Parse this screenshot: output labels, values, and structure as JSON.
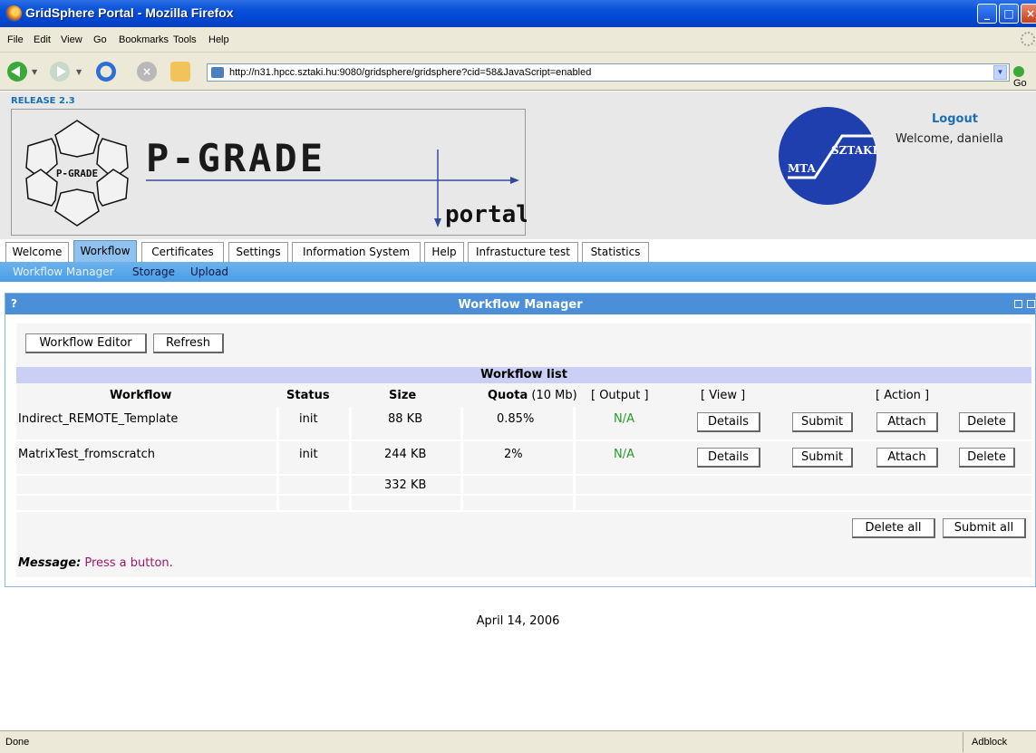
{
  "window": {
    "title": "GridSphere Portal - Mozilla Firefox"
  },
  "menu": [
    "File",
    "Edit",
    "View",
    "Go",
    "Bookmarks",
    "Tools",
    "Help"
  ],
  "address": {
    "url": "http://n31.hpcc.sztaki.hu:9080/gridsphere/gridsphere?cid=58&JavaScript=enabled",
    "go_label": "Go"
  },
  "header": {
    "release": "RELEASE 2.3",
    "logo_text": "P-GRADE",
    "logo_subtext": "portal",
    "small_logo_text": "P-GRADE",
    "partner_logo": {
      "left": "MTA",
      "right": "SZTAKI"
    },
    "logout": "Logout",
    "welcome": "Welcome, daniella"
  },
  "tabs": [
    {
      "label": "Welcome",
      "active": false
    },
    {
      "label": "Workflow",
      "active": true
    },
    {
      "label": "Certificates",
      "active": false
    },
    {
      "label": "Settings",
      "active": false
    },
    {
      "label": "Information System",
      "active": false
    },
    {
      "label": "Help",
      "active": false
    },
    {
      "label": "Infrastucture test",
      "active": false
    },
    {
      "label": "Statistics",
      "active": false
    }
  ],
  "subnav": [
    {
      "label": "Workflow Manager",
      "active": true
    },
    {
      "label": "Storage",
      "active": false
    },
    {
      "label": "Upload",
      "active": false
    }
  ],
  "portlet": {
    "help_marker": "?",
    "title": "Workflow Manager",
    "buttons": {
      "editor": "Workflow Editor",
      "refresh": "Refresh"
    },
    "list_title": "Workflow list",
    "columns": {
      "workflow": "Workflow",
      "status": "Status",
      "size": "Size",
      "quota": "Quota",
      "quota_unit": "(10 Mb)",
      "output": "[ Output ]",
      "view": "[ View ]",
      "action": "[ Action ]"
    },
    "rows": [
      {
        "name": "Indirect_REMOTE_Template",
        "status": "init",
        "size": "88 KB",
        "quota": "0.85%",
        "output": "N/A",
        "view": "Details",
        "submit": "Submit",
        "attach": "Attach",
        "delete": "Delete"
      },
      {
        "name": "MatrixTest_fromscratch",
        "status": "init",
        "size": "244 KB",
        "quota": "2%",
        "output": "N/A",
        "view": "Details",
        "submit": "Submit",
        "attach": "Attach",
        "delete": "Delete"
      }
    ],
    "total_size": "332 KB",
    "bottom_buttons": {
      "delete_all": "Delete all",
      "submit_all": "Submit all"
    },
    "message_label": "Message:",
    "message_text": "Press a button."
  },
  "date": "April 14, 2006",
  "status": {
    "left": "Done",
    "right": "Adblock"
  }
}
